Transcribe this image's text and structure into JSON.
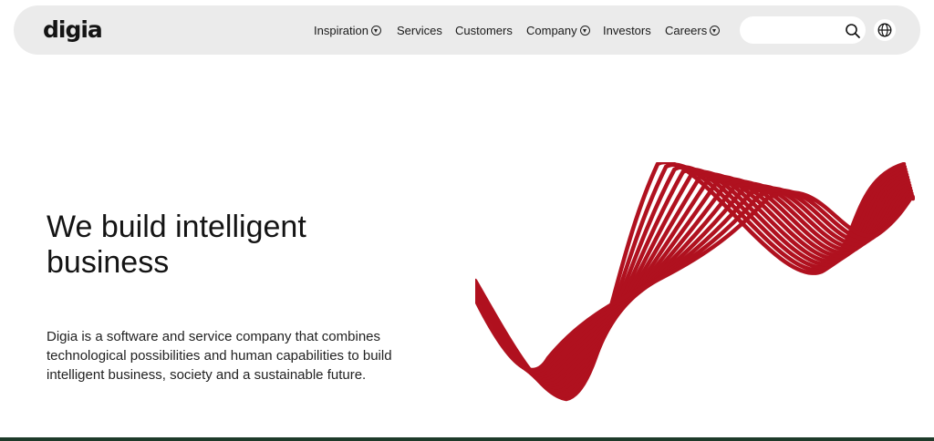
{
  "header": {
    "logo": "digia",
    "nav": [
      {
        "label": "Inspiration",
        "dropdown": true
      },
      {
        "label": "Services",
        "dropdown": false
      },
      {
        "label": "Customers",
        "dropdown": false
      },
      {
        "label": "Company",
        "dropdown": true
      },
      {
        "label": "Investors",
        "dropdown": false
      },
      {
        "label": "Careers",
        "dropdown": true
      }
    ],
    "search": {
      "value": "",
      "icon": "search-icon"
    },
    "language": {
      "icon": "globe-icon"
    }
  },
  "hero": {
    "title": "We build intelligent business",
    "description": "Digia is a software and service company that combines technological possibilities and human capabilities to build intelligent business, society and a sustainable future."
  },
  "colors": {
    "accent": "#b0111f",
    "nav_bg": "#ebebeb",
    "footer_strip": "#1e3b2a"
  }
}
